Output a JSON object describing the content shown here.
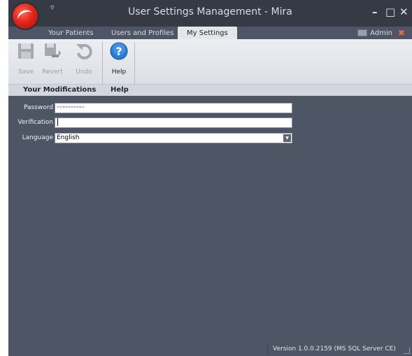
{
  "window": {
    "title": "User Settings Management - Mira",
    "quick_access_glyph": "▿",
    "controls": {
      "minimize": "–",
      "maximize": "□",
      "close": "✕"
    }
  },
  "tabs": [
    {
      "label": "Your Patients",
      "active": false
    },
    {
      "label": "Users and Profiles",
      "active": false
    },
    {
      "label": "My Settings",
      "active": true
    }
  ],
  "user": {
    "name": "Admin"
  },
  "ribbon": {
    "buttons": [
      {
        "label": "Save",
        "icon": "floppy-disk-icon",
        "enabled": false
      },
      {
        "label": "Revert",
        "icon": "revert-icon",
        "enabled": false
      },
      {
        "label": "Undo",
        "icon": "undo-icon",
        "enabled": false
      },
      {
        "label": "Help",
        "icon": "help-icon",
        "enabled": true
      }
    ],
    "groups": [
      "Your Modifications",
      "Help"
    ]
  },
  "form": {
    "password_label": "Password",
    "password_value": "**********",
    "verification_label": "Verification",
    "verification_value": "",
    "language_label": "Language",
    "language_value": "English"
  },
  "status": {
    "version": "Version 1.0.0.2159 (MS SQL Server CE)"
  },
  "colors": {
    "background": "#4e5665",
    "titlebar": "#353a45",
    "ribbon": "#e4e6ea",
    "help_blue": "#2a7bd4"
  }
}
